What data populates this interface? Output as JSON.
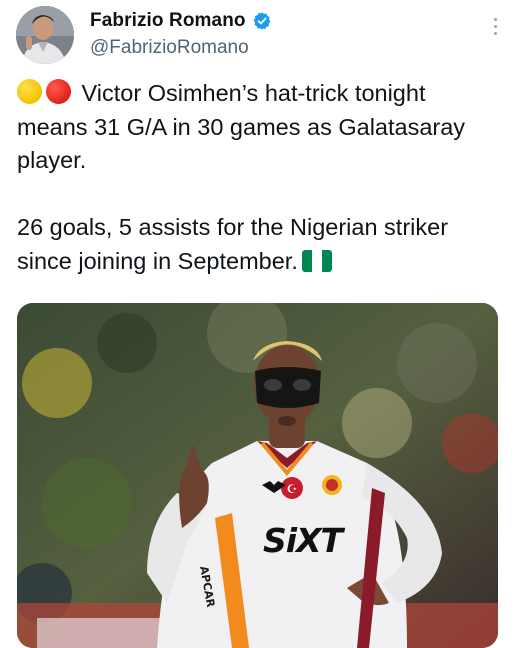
{
  "author": {
    "display_name": "Fabrizio Romano",
    "handle": "@FabrizioRomano",
    "verified": true
  },
  "tweet": {
    "paragraph1": "Victor Osimhen’s hat-trick tonight means 31 G/A in 30 games as Galatasaray player.",
    "paragraph2": "26 goals, 5 assists for the Nigerian striker since joining in September.",
    "emoji_lead": [
      "yellow-circle",
      "red-circle"
    ],
    "emoji_trail": "nigeria-flag"
  },
  "media": {
    "kit_sponsor": "SiXT",
    "sleeve_text": "APCAR",
    "colors": {
      "kit": "#f1f1f3",
      "accent_orange": "#f28a1e",
      "accent_maroon": "#8a1c2a",
      "mask": "#151515"
    }
  },
  "colors": {
    "text": "#0f1419",
    "secondary": "#536471",
    "verified": "#1d9bf0"
  }
}
